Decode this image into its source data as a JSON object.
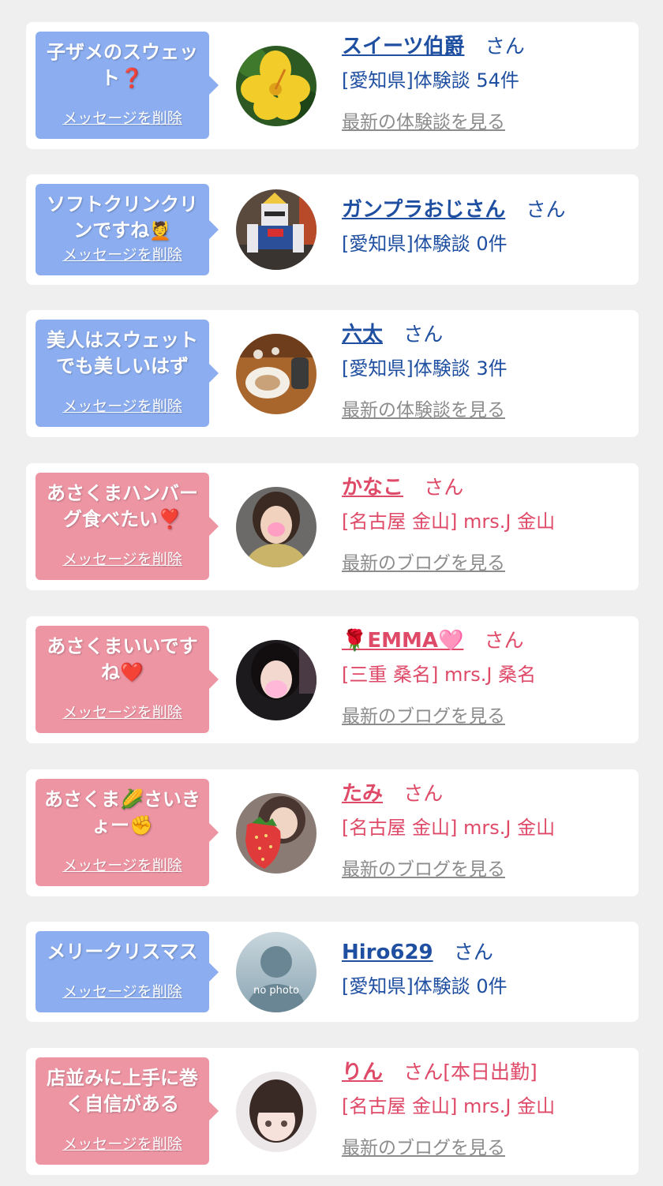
{
  "cards": [
    {
      "bubble_text": "子ザメのスウェット❓",
      "delete_label": "メッセージを削除",
      "name": "スイーツ伯爵",
      "suffix": "さん",
      "detail": "[愛知県]体験談 54件",
      "latest": "最新の体験談を見る",
      "theme": "blue",
      "avatar": "yellow-hibiscus-photo"
    },
    {
      "bubble_text": "ソフトクリンクリンですね",
      "bubble_emoji": "💆",
      "delete_label": "メッセージを削除",
      "name": "ガンプラおじさん",
      "suffix": "さん",
      "detail": "[愛知県]体験談 0件",
      "theme": "blue",
      "avatar": "gundam-model-photo"
    },
    {
      "bubble_text": "美人はスウェットでも美しいはず",
      "delete_label": "メッセージを削除",
      "name": "六太",
      "suffix": "さん",
      "detail": "[愛知県]体験談 3件",
      "latest": "最新の体験談を見る",
      "theme": "blue",
      "avatar": "food-plate-photo"
    },
    {
      "bubble_text": "あさくまハンバーグ食べたい❣️",
      "delete_label": "メッセージを削除",
      "name": "かなこ",
      "suffix": "さん",
      "detail": "[名古屋 金山] mrs.J 金山",
      "latest": "最新のブログを見る",
      "theme": "pink",
      "avatar": "woman-portrait-photo"
    },
    {
      "bubble_text": "あさくまいいですね❤️",
      "delete_label": "メッセージを削除",
      "name": "🌹EMMA🩷",
      "suffix": "さん",
      "detail": "[三重 桑名] mrs.J 桑名",
      "latest": "最新のブログを見る",
      "theme": "pink",
      "avatar": "woman-emma-photo"
    },
    {
      "bubble_text": "あさくま🌽さいきょー✊",
      "delete_label": "メッセージを削除",
      "name": "たみ",
      "suffix": "さん",
      "detail": "[名古屋 金山] mrs.J 金山",
      "latest": "最新のブログを見る",
      "theme": "pink",
      "avatar": "woman-strawberry-photo"
    },
    {
      "bubble_text": "メリークリスマス",
      "delete_label": "メッセージを削除",
      "name": "Hiro629",
      "suffix": "さん",
      "detail": "[愛知県]体験談 0件",
      "theme": "blue",
      "avatar": "no-photo-placeholder",
      "avatar_text": "no photo"
    },
    {
      "bubble_text": "店並みに上手に巻く自信がある",
      "delete_label": "メッセージを削除",
      "name": "りん",
      "suffix": "さん[本日出勤]",
      "detail": "[名古屋 金山] mrs.J 金山",
      "latest": "最新のブログを見る",
      "theme": "pink",
      "avatar": "woman-bangs-photo"
    }
  ],
  "colors": {
    "background": "#efefef",
    "card": "#ffffff",
    "bubble_blue": "#8caef0",
    "bubble_pink": "#ee95a4",
    "text_blue": "#1f4fa0",
    "text_pink": "#de4a68",
    "link_gray": "#8c8c8c"
  }
}
